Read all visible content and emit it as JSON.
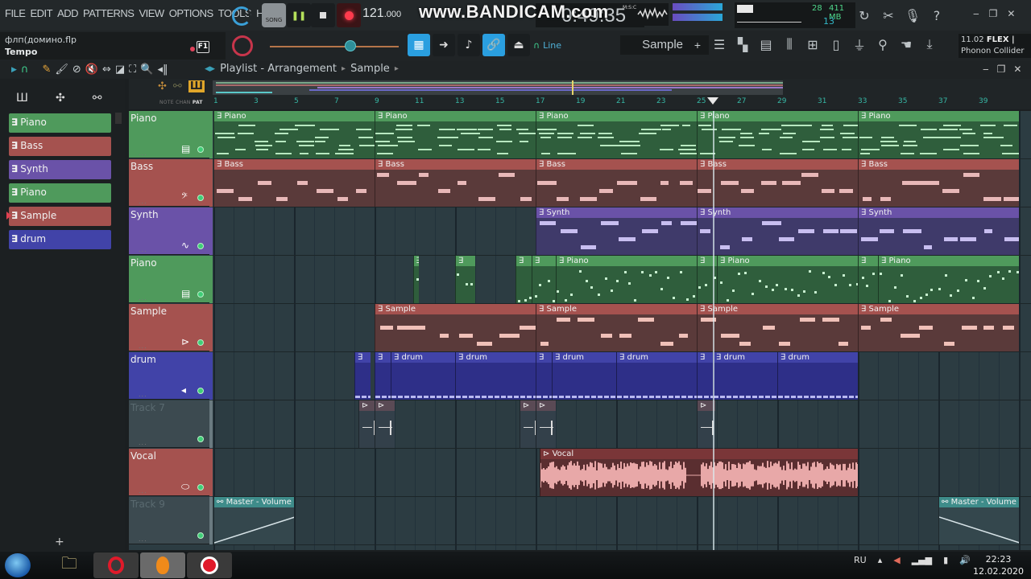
{
  "menu": [
    "FILE",
    "EDIT",
    "ADD",
    "PATTERNS",
    "VIEW",
    "OPTIONS",
    "TOOLS",
    "HELP"
  ],
  "file_info": {
    "filename": "флп(домино.flp",
    "hint": "Tempo",
    "f1_label": "F1"
  },
  "transport": {
    "mode_label": "SONG",
    "play_icon": "pause",
    "bpm": "121",
    "bpm_decimal": ".000"
  },
  "watermark": "www.BANDICAM.com",
  "time_display": {
    "value": "0:49:35",
    "label": "M:S:CS"
  },
  "cpu_panel": {
    "cpu": "28",
    "memory": "411 MB",
    "polyphony": "13"
  },
  "toolbar2": {
    "snap_label": "Line",
    "pattern_name": "Sample",
    "add_label": "+"
  },
  "hint_panel": {
    "version": "11.02",
    "plugin_type": "FLEX |",
    "plugin_name": "Phonon Collider"
  },
  "playlist": {
    "breadcrumb": [
      "Playlist - Arrangement",
      "Sample"
    ],
    "ruler_modes": {
      "note": "NOTE",
      "chan": "CHAN",
      "pat": "PAT"
    },
    "bar_numbers": [
      1,
      3,
      5,
      7,
      9,
      11,
      13,
      15,
      17,
      19,
      21,
      23,
      25,
      27,
      29,
      31,
      33,
      35,
      37,
      39
    ],
    "playhead_bar": 25.8
  },
  "picker": {
    "items": [
      {
        "label": "Piano",
        "color": "#4f9a5c"
      },
      {
        "label": "Bass",
        "color": "#a5524f"
      },
      {
        "label": "Synth",
        "color": "#6a52a8"
      },
      {
        "label": "Piano",
        "color": "#4f9a5c"
      },
      {
        "label": "Sample",
        "color": "#a5524f",
        "selected": true
      },
      {
        "label": "drum",
        "color": "#4143a8"
      }
    ],
    "add_label": "+"
  },
  "tracks": [
    {
      "name": "Piano",
      "color": "#4f9a5c",
      "icon": "piano-icon",
      "icon_glyph": "▤"
    },
    {
      "name": "Bass",
      "color": "#a5524f",
      "icon": "bass-clef-icon",
      "icon_glyph": "𝄢"
    },
    {
      "name": "Synth",
      "color": "#6a52a8",
      "icon": "wave-icon",
      "icon_glyph": "∿"
    },
    {
      "name": "Piano",
      "color": "#4f9a5c",
      "icon": "piano-icon",
      "icon_glyph": "▤"
    },
    {
      "name": "Sample",
      "color": "#a5524f",
      "icon": "sample-icon",
      "icon_glyph": "⊳"
    },
    {
      "name": "drum",
      "color": "#4143a8",
      "icon": "drum-icon",
      "icon_glyph": "◂"
    },
    {
      "name": "Track 7",
      "color": "#3c4a50",
      "empty": true
    },
    {
      "name": "Vocal",
      "color": "#a5524f",
      "icon": "lips-icon",
      "icon_glyph": "⬭"
    },
    {
      "name": "Track 9",
      "color": "#3c4a50",
      "empty": true
    }
  ],
  "clips": [
    {
      "track": 0,
      "label": "Piano",
      "start": 1,
      "end": 9,
      "type": "piano",
      "color": "#4f9a5c",
      "body": "#2f5e3c"
    },
    {
      "track": 0,
      "label": "Piano",
      "start": 9,
      "end": 17,
      "type": "piano",
      "color": "#4f9a5c",
      "body": "#2f5e3c"
    },
    {
      "track": 0,
      "label": "Piano",
      "start": 17,
      "end": 25,
      "type": "piano",
      "color": "#4f9a5c",
      "body": "#2f5e3c"
    },
    {
      "track": 0,
      "label": "Piano",
      "start": 25,
      "end": 33,
      "type": "piano",
      "color": "#4f9a5c",
      "body": "#2f5e3c"
    },
    {
      "track": 0,
      "label": "Piano",
      "start": 33,
      "end": 41,
      "type": "piano",
      "color": "#4f9a5c",
      "body": "#2f5e3c"
    },
    {
      "track": 1,
      "label": "Bass",
      "start": 1,
      "end": 9,
      "type": "bass",
      "color": "#a5524f",
      "body": "#5a3a3a"
    },
    {
      "track": 1,
      "label": "Bass",
      "start": 9,
      "end": 17,
      "type": "bass",
      "color": "#a5524f",
      "body": "#5a3a3a"
    },
    {
      "track": 1,
      "label": "Bass",
      "start": 17,
      "end": 25,
      "type": "bass",
      "color": "#a5524f",
      "body": "#5a3a3a"
    },
    {
      "track": 1,
      "label": "Bass",
      "start": 25,
      "end": 33,
      "type": "bass",
      "color": "#a5524f",
      "body": "#5a3a3a"
    },
    {
      "track": 1,
      "label": "Bass",
      "start": 33,
      "end": 41,
      "type": "bass",
      "color": "#a5524f",
      "body": "#5a3a3a"
    },
    {
      "track": 2,
      "label": "Synth",
      "start": 17,
      "end": 25,
      "type": "synth",
      "color": "#6a52a8",
      "body": "#3f3a6a"
    },
    {
      "track": 2,
      "label": "Synth",
      "start": 25,
      "end": 33,
      "type": "synth",
      "color": "#6a52a8",
      "body": "#3f3a6a"
    },
    {
      "track": 2,
      "label": "Synth",
      "start": 33,
      "end": 41,
      "type": "synth",
      "color": "#6a52a8",
      "body": "#3f3a6a"
    },
    {
      "track": 3,
      "label": "",
      "start": 10.9,
      "end": 11.2,
      "type": "dots",
      "color": "#4f9a5c",
      "body": "#2f5e3c"
    },
    {
      "track": 3,
      "label": "",
      "start": 13,
      "end": 14,
      "type": "dots",
      "color": "#4f9a5c",
      "body": "#2f5e3c"
    },
    {
      "track": 3,
      "label": "",
      "start": 16,
      "end": 16.8,
      "type": "dots",
      "color": "#4f9a5c",
      "body": "#2f5e3c"
    },
    {
      "track": 3,
      "label": "",
      "start": 16.8,
      "end": 18,
      "type": "dots",
      "color": "#4f9a5c",
      "body": "#2f5e3c"
    },
    {
      "track": 3,
      "label": "Piano",
      "start": 18,
      "end": 25,
      "type": "dots",
      "color": "#4f9a5c",
      "body": "#2f5e3c"
    },
    {
      "track": 3,
      "label": "",
      "start": 25,
      "end": 26,
      "type": "dots",
      "color": "#4f9a5c",
      "body": "#2f5e3c"
    },
    {
      "track": 3,
      "label": "Piano",
      "start": 26,
      "end": 33,
      "type": "dots",
      "color": "#4f9a5c",
      "body": "#2f5e3c"
    },
    {
      "track": 3,
      "label": "",
      "start": 33,
      "end": 34,
      "type": "dots",
      "color": "#4f9a5c",
      "body": "#2f5e3c"
    },
    {
      "track": 3,
      "label": "Piano",
      "start": 34,
      "end": 41,
      "type": "dots",
      "color": "#4f9a5c",
      "body": "#2f5e3c"
    },
    {
      "track": 4,
      "label": "Sample",
      "start": 9,
      "end": 17,
      "type": "sample",
      "color": "#a5524f",
      "body": "#5a3a3a"
    },
    {
      "track": 4,
      "label": "Sample",
      "start": 17,
      "end": 25,
      "type": "sample",
      "color": "#a5524f",
      "body": "#5a3a3a"
    },
    {
      "track": 4,
      "label": "Sample",
      "start": 25,
      "end": 33,
      "type": "sample",
      "color": "#a5524f",
      "body": "#5a3a3a"
    },
    {
      "track": 4,
      "label": "Sample",
      "start": 33,
      "end": 41,
      "type": "sample",
      "color": "#a5524f",
      "body": "#5a3a3a"
    },
    {
      "track": 5,
      "label": "",
      "start": 8,
      "end": 8.8,
      "type": "drum",
      "color": "#4143a8",
      "body": "#2e2f88"
    },
    {
      "track": 5,
      "label": "",
      "start": 9,
      "end": 9.8,
      "type": "drum",
      "color": "#4143a8",
      "body": "#2e2f88"
    },
    {
      "track": 5,
      "label": "drum",
      "start": 9.8,
      "end": 13,
      "type": "drum",
      "color": "#4143a8",
      "body": "#2e2f88"
    },
    {
      "track": 5,
      "label": "drum",
      "start": 13,
      "end": 17,
      "type": "drum",
      "color": "#4143a8",
      "body": "#2e2f88"
    },
    {
      "track": 5,
      "label": "",
      "start": 17,
      "end": 17.8,
      "type": "drum",
      "color": "#4143a8",
      "body": "#2e2f88"
    },
    {
      "track": 5,
      "label": "drum",
      "start": 17.8,
      "end": 21,
      "type": "drum",
      "color": "#4143a8",
      "body": "#2e2f88"
    },
    {
      "track": 5,
      "label": "drum",
      "start": 21,
      "end": 25,
      "type": "drum",
      "color": "#4143a8",
      "body": "#2e2f88"
    },
    {
      "track": 5,
      "label": "",
      "start": 25,
      "end": 25.8,
      "type": "drum",
      "color": "#4143a8",
      "body": "#2e2f88"
    },
    {
      "track": 5,
      "label": "drum",
      "start": 25.8,
      "end": 29,
      "type": "drum",
      "color": "#4143a8",
      "body": "#2e2f88"
    },
    {
      "track": 5,
      "label": "drum",
      "start": 29,
      "end": 33,
      "type": "drum",
      "color": "#4143a8",
      "body": "#2e2f88"
    },
    {
      "track": 6,
      "label": "",
      "start": 8.2,
      "end": 9,
      "type": "hit",
      "color": "#5a4a55",
      "body": "#33404a"
    },
    {
      "track": 6,
      "label": "",
      "start": 9,
      "end": 10,
      "type": "hit",
      "color": "#5a4a55",
      "body": "#33404a"
    },
    {
      "track": 6,
      "label": "",
      "start": 16.2,
      "end": 17,
      "type": "hit",
      "color": "#5a4a55",
      "body": "#33404a"
    },
    {
      "track": 6,
      "label": "",
      "start": 17,
      "end": 18,
      "type": "hit",
      "color": "#5a4a55",
      "body": "#33404a"
    },
    {
      "track": 6,
      "label": "",
      "start": 25,
      "end": 25.9,
      "type": "hit",
      "color": "#5a4a55",
      "body": "#33404a"
    },
    {
      "track": 7,
      "label": "Vocal",
      "start": 17.2,
      "end": 33,
      "type": "audio",
      "color": "#7a3638",
      "body": "#5a2e30"
    },
    {
      "track": 8,
      "label": "Master - Volume",
      "start": 1,
      "end": 5,
      "type": "auto-up",
      "color": "#3e8c8a",
      "body": "#34474d"
    },
    {
      "track": 8,
      "label": "Master - Volume",
      "start": 37,
      "end": 41,
      "type": "auto-down",
      "color": "#3e8c8a",
      "body": "#34474d"
    }
  ],
  "taskbar": {
    "apps": [
      "windows-explorer",
      "opera-browser",
      "fl-studio",
      "bandicam"
    ],
    "language": "RU",
    "time": "22:23",
    "date": "12.02.2020"
  }
}
